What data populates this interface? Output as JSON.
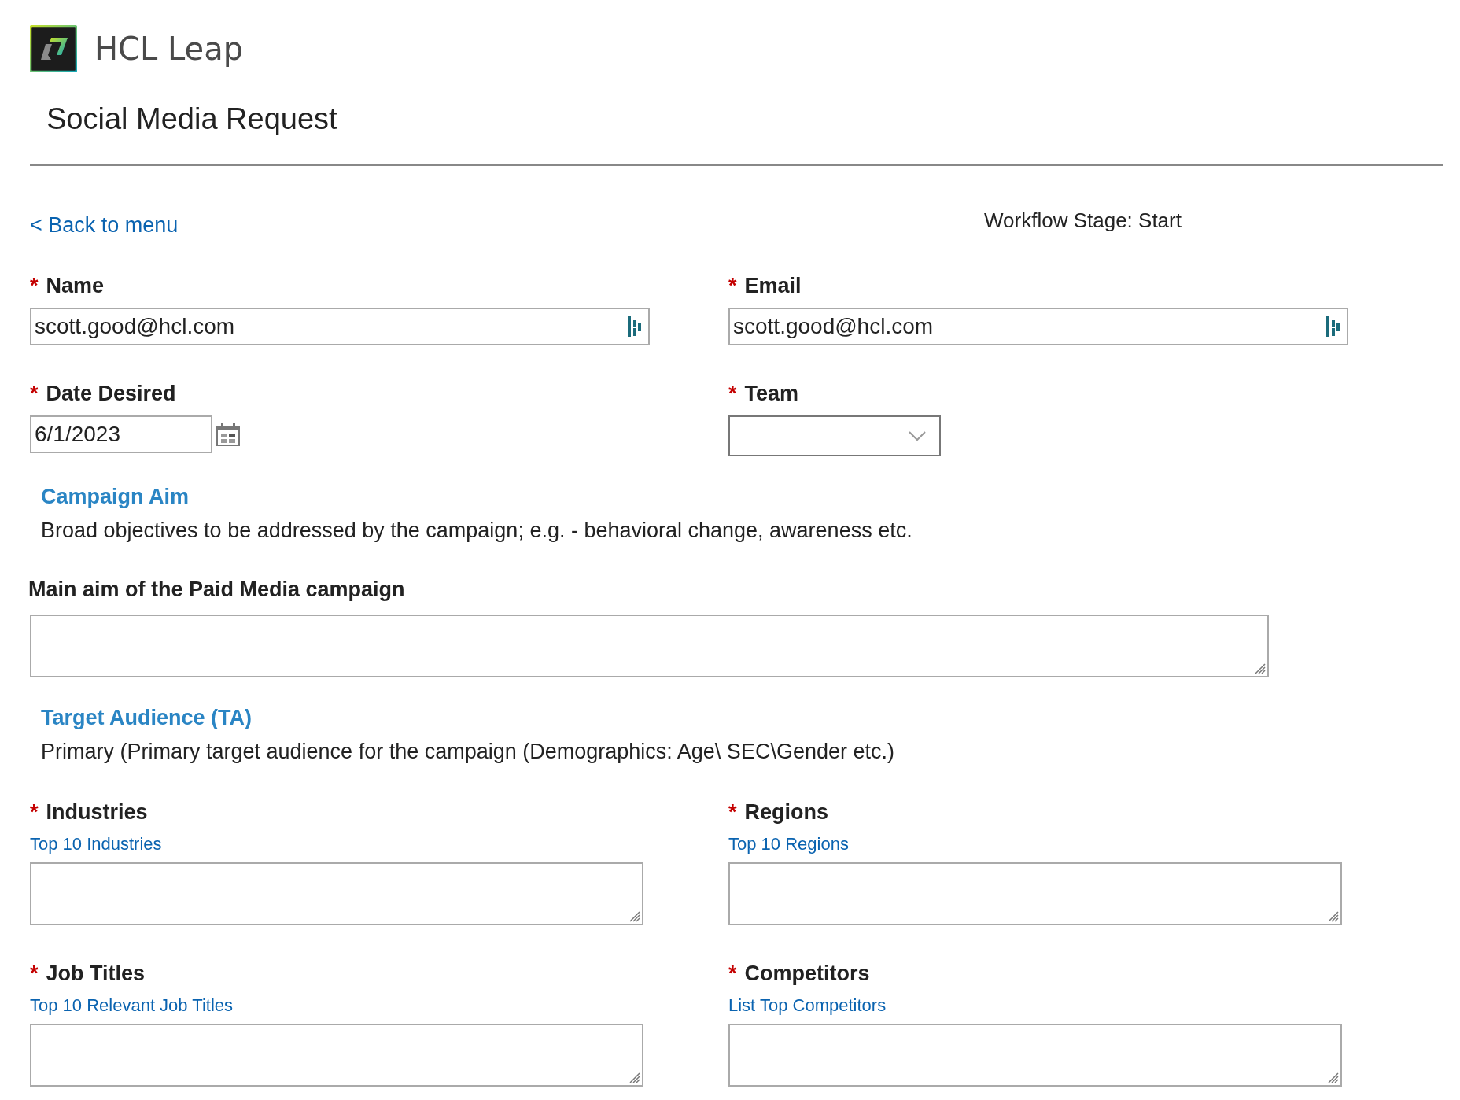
{
  "header": {
    "brand": "HCL Leap",
    "title": "Social Media Request"
  },
  "back_link": "< Back to menu",
  "workflow_stage": "Workflow Stage: Start",
  "form_items": [
    {
      "kind": "pair",
      "fields": [
        {
          "kind": "text",
          "required_mark": "*",
          "label": "Name",
          "value": "scott.good@hcl.com"
        },
        {
          "kind": "text",
          "required_mark": "*",
          "label": "Email",
          "value": "scott.good@hcl.com"
        }
      ]
    },
    {
      "kind": "pair",
      "fields": [
        {
          "kind": "date",
          "required_mark": "*",
          "label": "Date Desired",
          "value": "6/1/2023"
        },
        {
          "kind": "select",
          "required_mark": "*",
          "label": "Team"
        }
      ]
    },
    {
      "kind": "info",
      "heading": "Campaign Aim",
      "text": "Broad objectives to be addressed by the campaign; e.g. - behavioral change, awareness etc."
    },
    {
      "kind": "single",
      "fields": [
        {
          "kind": "textarea",
          "label": "Main aim of the Paid Media campaign"
        }
      ]
    },
    {
      "kind": "info",
      "heading": "Target Audience (TA)",
      "text": "Primary (Primary target audience for the campaign (Demographics: Age\\ SEC\\Gender etc.)"
    },
    {
      "kind": "pair",
      "fields": [
        {
          "kind": "textarea",
          "required_mark": "*",
          "label": "Industries",
          "hint": "Top 10 Industries"
        },
        {
          "kind": "textarea",
          "required_mark": "*",
          "label": "Regions",
          "hint": "Top 10 Regions"
        }
      ]
    },
    {
      "kind": "pair",
      "fields": [
        {
          "kind": "textarea",
          "required_mark": "*",
          "label": "Job Titles",
          "hint": "Top 10 Relevant Job Titles"
        },
        {
          "kind": "textarea",
          "required_mark": "*",
          "label": "Competitors",
          "hint": "List Top Competitors"
        }
      ]
    }
  ]
}
